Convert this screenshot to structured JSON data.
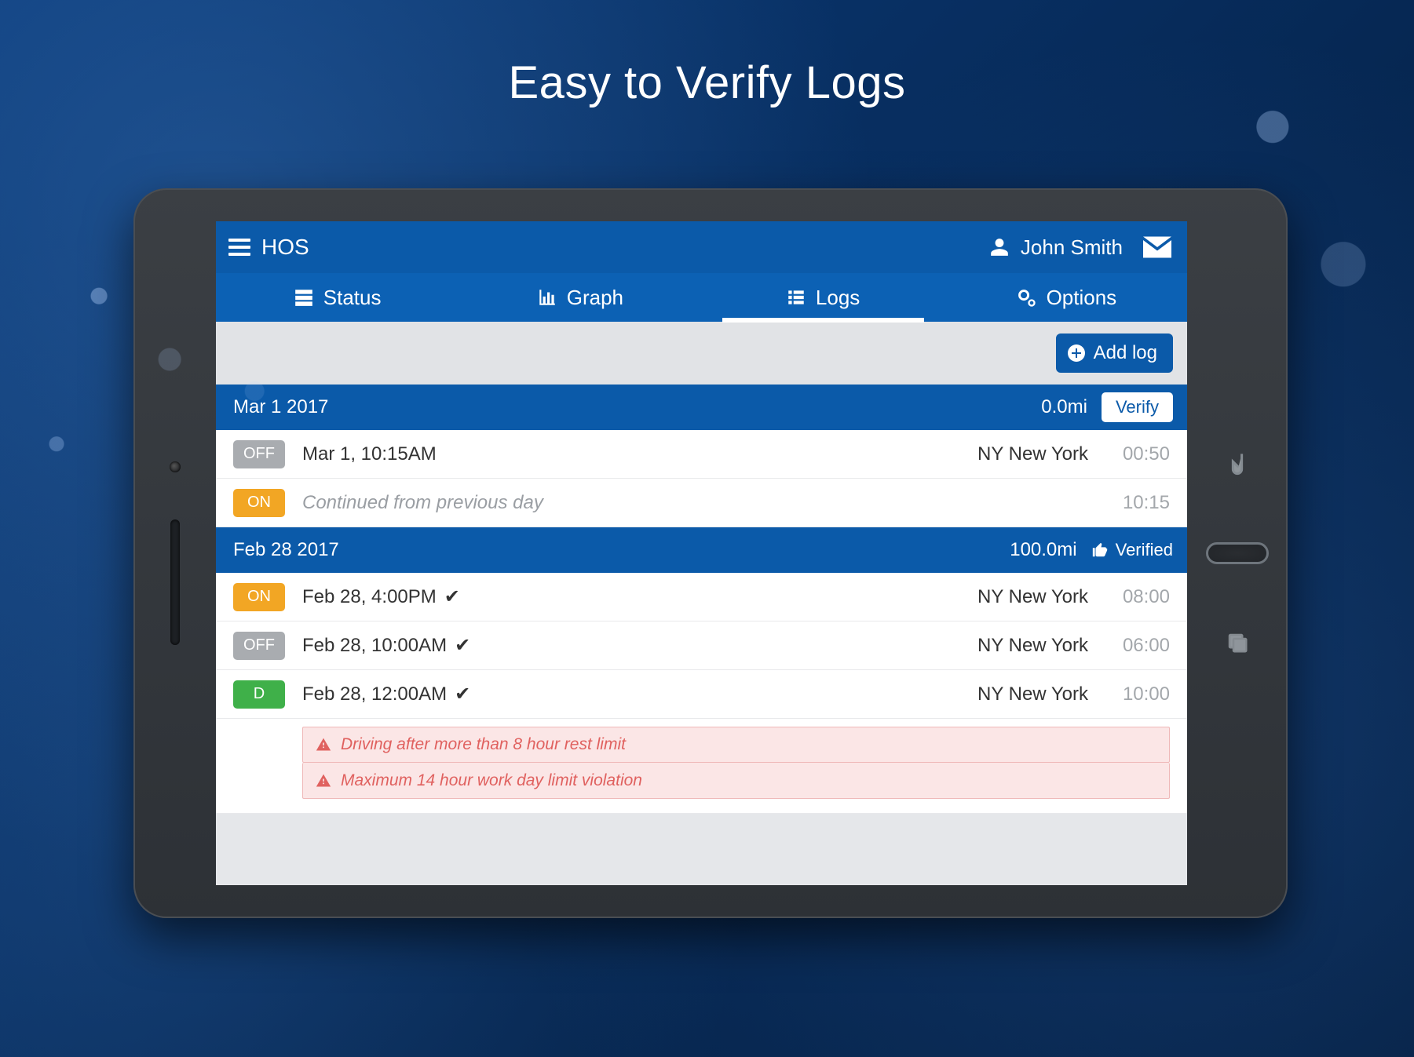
{
  "hero_title": "Easy to Verify Logs",
  "header": {
    "title": "HOS",
    "user_name": "John Smith"
  },
  "tabs": {
    "status": "Status",
    "graph": "Graph",
    "logs": "Logs",
    "options": "Options",
    "active": "logs"
  },
  "toolbar": {
    "add_log": "Add log"
  },
  "groups": [
    {
      "date": "Mar 1 2017",
      "miles": "0.0mi",
      "verify_label": "Verify",
      "verified": false,
      "rows": [
        {
          "badge": "OFF",
          "badge_kind": "off",
          "time": "Mar 1, 10:15AM",
          "checked": false,
          "location": "NY New York",
          "duration": "00:50",
          "muted": false
        },
        {
          "badge": "ON",
          "badge_kind": "on",
          "time": "Continued from previous day",
          "checked": false,
          "location": "",
          "duration": "10:15",
          "muted": true
        }
      ],
      "violations": []
    },
    {
      "date": "Feb 28 2017",
      "miles": "100.0mi",
      "verified_label": "Verified",
      "verified": true,
      "rows": [
        {
          "badge": "ON",
          "badge_kind": "on",
          "time": "Feb 28, 4:00PM",
          "checked": true,
          "location": "NY New York",
          "duration": "08:00",
          "muted": false
        },
        {
          "badge": "OFF",
          "badge_kind": "off",
          "time": "Feb 28, 10:00AM",
          "checked": true,
          "location": "NY New York",
          "duration": "06:00",
          "muted": false
        },
        {
          "badge": "D",
          "badge_kind": "d",
          "time": "Feb 28, 12:00AM",
          "checked": true,
          "location": "NY New York",
          "duration": "10:00",
          "muted": false
        }
      ],
      "violations": [
        "Driving after more than 8 hour rest limit",
        "Maximum 14 hour work day limit violation"
      ]
    }
  ]
}
